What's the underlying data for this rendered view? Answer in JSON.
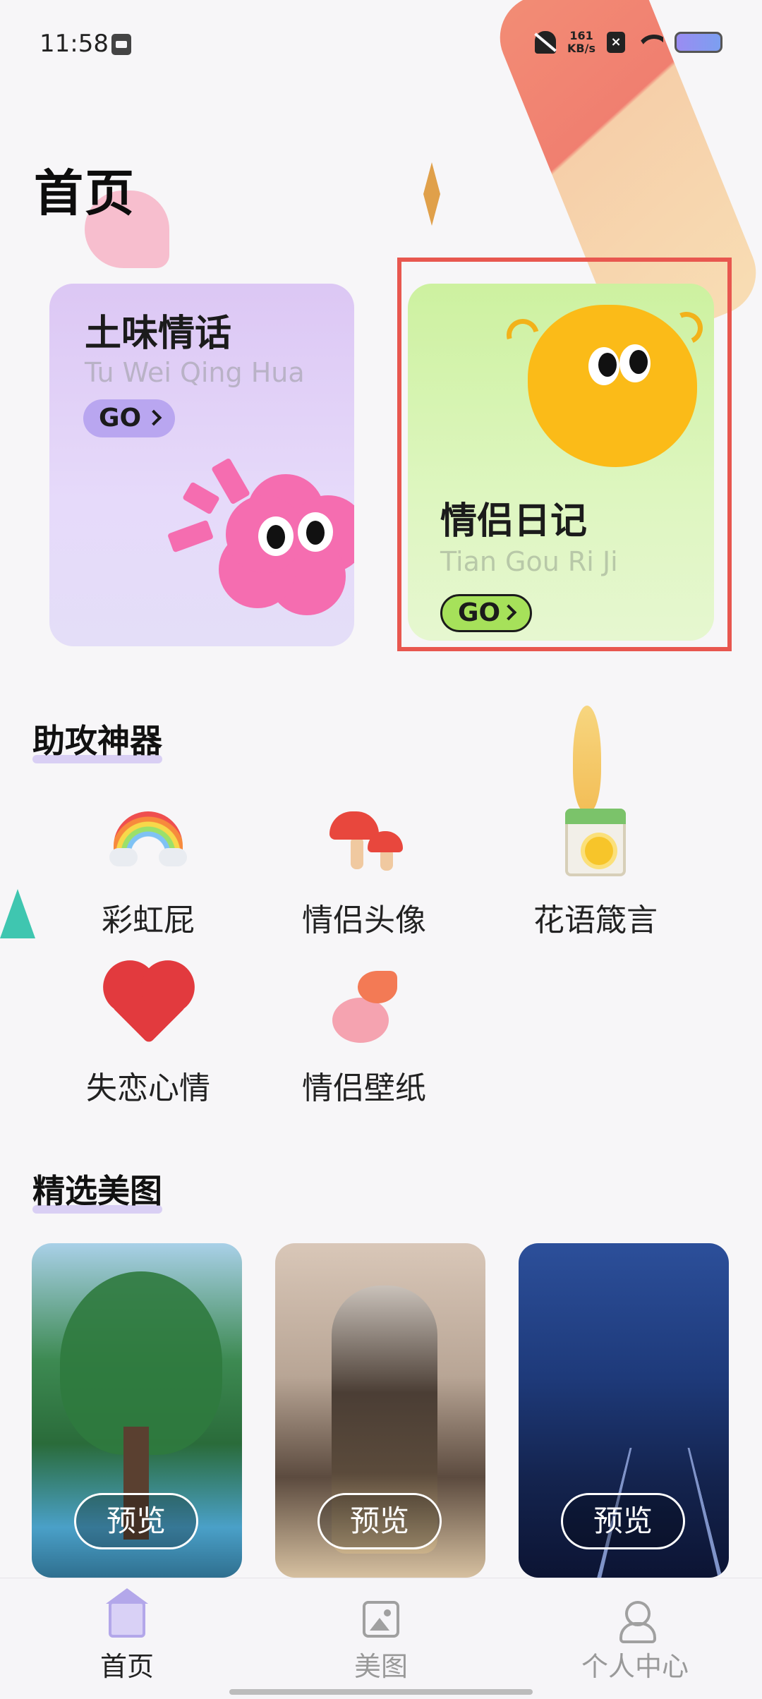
{
  "status_bar": {
    "time": "11:58",
    "net_speed_value": "161",
    "net_speed_unit": "KB/s",
    "icons": [
      "sim-icon",
      "bell-off-icon",
      "x-icon",
      "wifi-icon",
      "battery-icon"
    ]
  },
  "page": {
    "title": "首页"
  },
  "cards": [
    {
      "title": "土味情话",
      "subtitle": "Tu Wei Qing Hua",
      "go_label": "GO"
    },
    {
      "title": "情侣日记",
      "subtitle": "Tian Gou Ri Ji",
      "go_label": "GO"
    }
  ],
  "tools_section": {
    "title": "助攻神器",
    "items": [
      {
        "label": "彩虹屁",
        "icon": "rainbow-icon"
      },
      {
        "label": "情侣头像",
        "icon": "mushroom-icon"
      },
      {
        "label": "花语箴言",
        "icon": "calendar-flower-icon"
      },
      {
        "label": "失恋心情",
        "icon": "broken-heart-icon"
      },
      {
        "label": "情侣壁纸",
        "icon": "butterfly-peach-icon"
      }
    ]
  },
  "gallery_section": {
    "title": "精选美图",
    "items": [
      {
        "preview_label": "预览"
      },
      {
        "preview_label": "预览"
      },
      {
        "preview_label": "预览"
      }
    ]
  },
  "bottom_nav": [
    {
      "label": "首页",
      "icon": "home-icon",
      "active": true
    },
    {
      "label": "美图",
      "icon": "image-icon",
      "active": false
    },
    {
      "label": "个人中心",
      "icon": "user-icon",
      "active": false
    }
  ],
  "colors": {
    "accent": "#b3a7ea",
    "highlight_border": "#e8574f",
    "card_purple": "#dcc7f4",
    "card_green": "#cdf1a0"
  }
}
